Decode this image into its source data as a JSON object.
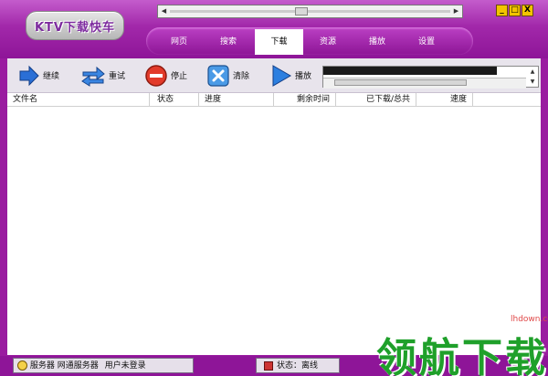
{
  "app": {
    "logo_text": "KTV下载快车",
    "window_buttons": {
      "minimize": "_",
      "maximize": "□",
      "close": "X"
    }
  },
  "nav": {
    "tabs": [
      {
        "label": "网页",
        "active": false
      },
      {
        "label": "搜索",
        "active": false
      },
      {
        "label": "下载",
        "active": true
      },
      {
        "label": "资源",
        "active": false
      },
      {
        "label": "播放",
        "active": false
      },
      {
        "label": "设置",
        "active": false
      }
    ]
  },
  "toolbar": {
    "continue": {
      "label": "继续",
      "icon": "arrow-right-icon"
    },
    "retry": {
      "label": "重试",
      "icon": "refresh-icon"
    },
    "stop": {
      "label": "停止",
      "icon": "stop-icon"
    },
    "clear": {
      "label": "清除",
      "icon": "clear-icon"
    },
    "play": {
      "label": "播放",
      "icon": "play-icon"
    }
  },
  "list": {
    "columns": [
      "文件名",
      "状态",
      "进度",
      "剩余时间",
      "已下载/总共",
      "速度"
    ],
    "rows": []
  },
  "status": {
    "server": "服务器 网通服务器",
    "login": "用户未登录",
    "state": "状态：离线"
  },
  "watermark": {
    "text": "领航下载",
    "url": "lhdown.com"
  },
  "colors": {
    "accent": "#9a1ca0",
    "tab_active_bg": "#ffffff",
    "toolbar_bg": "#e8e4ec",
    "watermark_green": "#1fa02a"
  }
}
